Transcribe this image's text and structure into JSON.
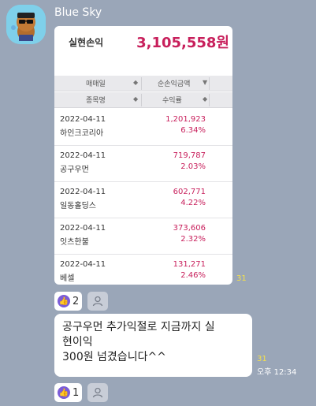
{
  "sender": {
    "name": "Blue Sky"
  },
  "card": {
    "realized_label": "실현손익",
    "realized_value": "3,105,558원",
    "header1": {
      "col1": "매매일",
      "col2": "순손익금액"
    },
    "header2": {
      "col1": "종목명",
      "col2": "수익률"
    },
    "rows": [
      {
        "date": "2022-04-11",
        "name": "하인크코리아",
        "amount": "1,201,923",
        "rate": "6.34%"
      },
      {
        "date": "2022-04-11",
        "name": "공구우먼",
        "amount": "719,787",
        "rate": "2.03%"
      },
      {
        "date": "2022-04-11",
        "name": "일동홀딩스",
        "amount": "602,771",
        "rate": "4.22%"
      },
      {
        "date": "2022-04-11",
        "name": "잇츠한불",
        "amount": "373,606",
        "rate": "2.32%"
      },
      {
        "date": "2022-04-11",
        "name": "베셀",
        "amount": "131,271",
        "rate": "2.46%"
      }
    ]
  },
  "image_message": {
    "unread_count": "31",
    "reaction_count": "2"
  },
  "text_message": {
    "lines": [
      "공구우먼 추가익절로  지금까지 실",
      "현이익",
      "300원 넘겼습니다^^"
    ],
    "unread_count": "31",
    "time": "오후 12:34",
    "reaction_count": "1"
  },
  "colors": {
    "background": "#9aa6b8",
    "profit": "#c8205c",
    "unread": "#f5e14a",
    "reaction": "#7b5cd8"
  },
  "icons": [
    "avatar",
    "thumbs-up-icon",
    "person-icon",
    "sort-arrow-icon"
  ]
}
